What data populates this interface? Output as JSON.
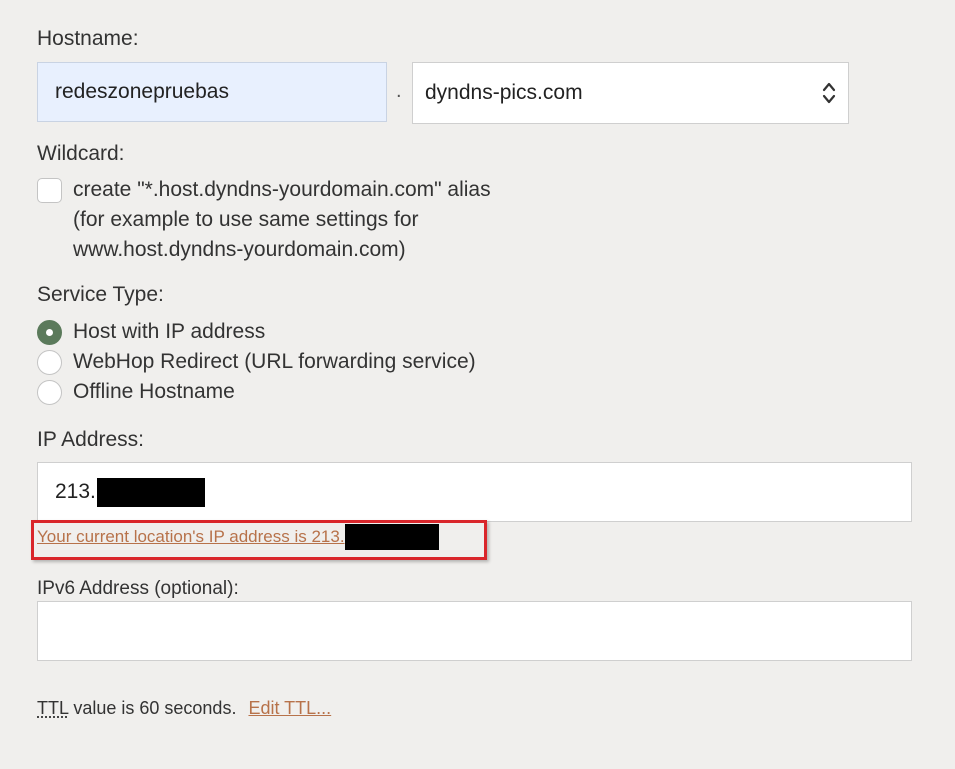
{
  "hostname": {
    "label": "Hostname:",
    "value": "redeszonepruebas",
    "separator": ".",
    "domain_selected": "dyndns-pics.com"
  },
  "wildcard": {
    "label": "Wildcard:",
    "checked": false,
    "lines": [
      "create \"*.host.dyndns-yourdomain.com\" alias",
      "(for example to use same settings for",
      "www.host.dyndns-yourdomain.com)"
    ]
  },
  "service_type": {
    "label": "Service Type:",
    "options": [
      {
        "label": "Host with IP address",
        "checked": true
      },
      {
        "label": "WebHop Redirect (URL forwarding service)",
        "checked": false
      },
      {
        "label": "Offline Hostname",
        "checked": false
      }
    ]
  },
  "ip_address": {
    "label": "IP Address:",
    "value_prefix": "213.",
    "current_location_link": "Your current location's IP address is 213."
  },
  "ipv6": {
    "label": "IPv6 Address (optional):",
    "value": ""
  },
  "ttl": {
    "abbr": "TTL",
    "text": " value is 60 seconds.",
    "edit_link": "Edit TTL..."
  },
  "colors": {
    "background": "#f0efed",
    "radio_checked": "#5b7a5b",
    "link": "#b7724a",
    "highlight_border": "#d9262b",
    "autofill_bg": "#e8f0fe"
  },
  "icons": {
    "domain_select": "up-down-chevron-icon",
    "radio_selected": "radio-dot-icon"
  }
}
